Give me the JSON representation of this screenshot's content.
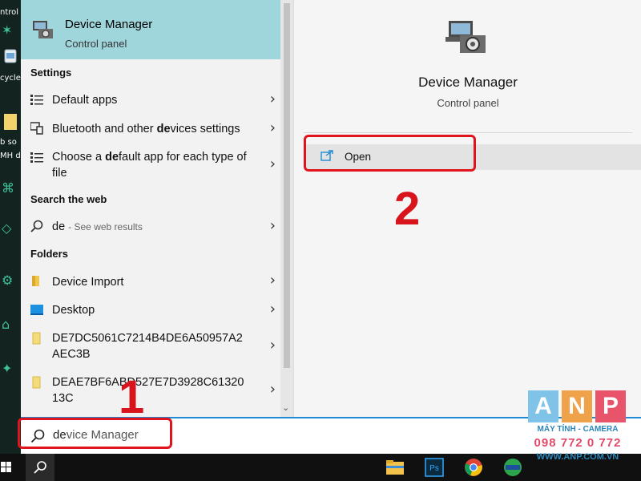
{
  "desktop": {
    "items": [
      "ntrol I",
      "cycle",
      "b so",
      "MH d"
    ]
  },
  "best_match": {
    "title": "Device Manager",
    "subtitle": "Control panel"
  },
  "settings": {
    "header": "Settings",
    "items": [
      {
        "label": "Default apps",
        "icon": "default-apps-icon"
      },
      {
        "pre": "Bluetooth and other ",
        "bold": "de",
        "post": "vices settings",
        "icon": "bluetooth-devices-icon"
      },
      {
        "pre": "Choose a ",
        "bold": "de",
        "post": "fault app for each type of file",
        "icon": "default-app-type-icon"
      }
    ]
  },
  "web": {
    "header": "Search the web",
    "query": "de",
    "hint": "- See web results",
    "icon": "search-icon"
  },
  "folders": {
    "header": "Folders",
    "items": [
      {
        "label": "Device Import",
        "icon": "folder-icon"
      },
      {
        "label": "Desktop",
        "icon": "desktop-folder-icon"
      },
      {
        "label": "DE7DC5061C7214B4DE6A50957A2AEC3B",
        "icon": "file-icon"
      },
      {
        "label": "DEAE7BF6ABD527E7D3928C6132013C",
        "icon": "file-icon"
      }
    ]
  },
  "preview": {
    "title": "Device Manager",
    "subtitle": "Control panel",
    "open_label": "Open"
  },
  "search": {
    "typed": "de",
    "completion": "vice Manager"
  },
  "annotations": {
    "step1": "1",
    "step2": "2"
  },
  "watermark": {
    "letters": [
      "A",
      "N",
      "P"
    ],
    "tagline": "MÁY TÍNH - CAMERA",
    "phone": "098 772 0 772",
    "site": "WWW.ANP.COM.VN"
  },
  "colors": {
    "selected_bg": "#9fd6dc",
    "accent": "#1f8ad4",
    "annotation": "#e0141c"
  }
}
